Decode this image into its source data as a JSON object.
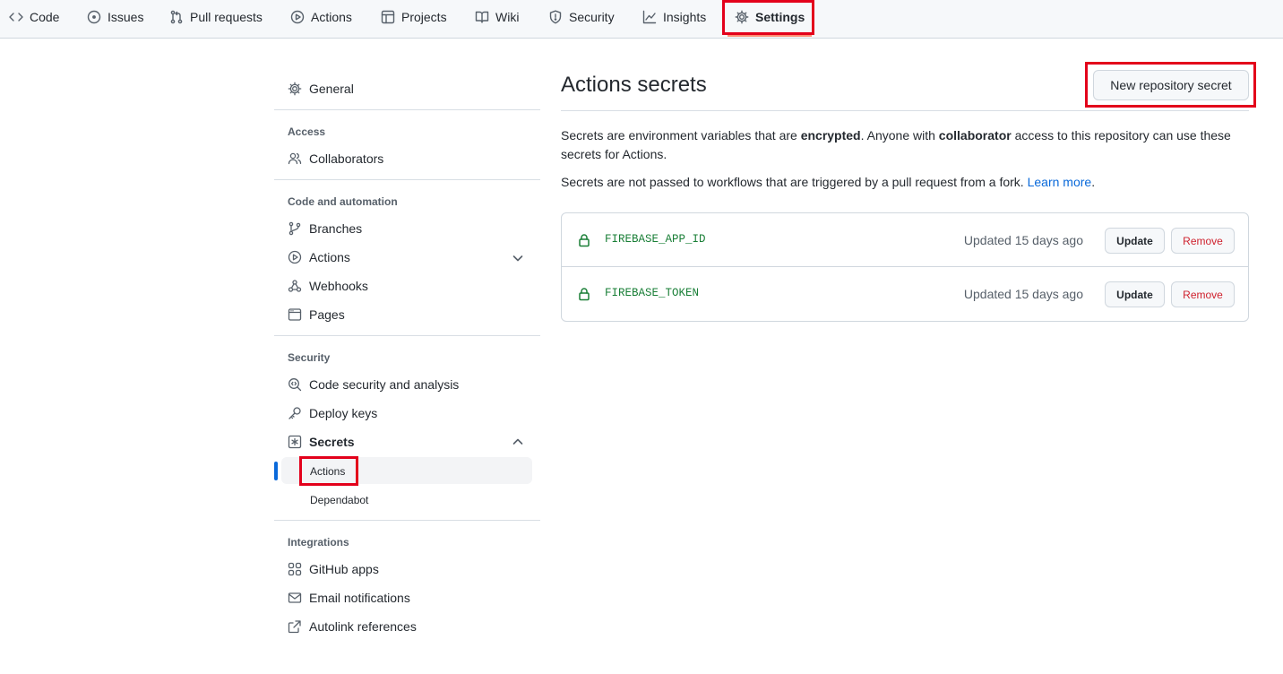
{
  "nav": {
    "tabs": [
      {
        "label": "Code",
        "icon": "code-icon"
      },
      {
        "label": "Issues",
        "icon": "issue-opened-icon"
      },
      {
        "label": "Pull requests",
        "icon": "git-pull-request-icon"
      },
      {
        "label": "Actions",
        "icon": "play-icon"
      },
      {
        "label": "Projects",
        "icon": "table-icon"
      },
      {
        "label": "Wiki",
        "icon": "book-icon"
      },
      {
        "label": "Security",
        "icon": "shield-icon"
      },
      {
        "label": "Insights",
        "icon": "graph-icon"
      },
      {
        "label": "Settings",
        "icon": "gear-icon",
        "selected": true
      }
    ]
  },
  "sidebar": {
    "general": "General",
    "access_heading": "Access",
    "collaborators": "Collaborators",
    "code_heading": "Code and automation",
    "branches": "Branches",
    "actions": "Actions",
    "webhooks": "Webhooks",
    "pages": "Pages",
    "security_heading": "Security",
    "code_security": "Code security and analysis",
    "deploy_keys": "Deploy keys",
    "secrets": "Secrets",
    "secrets_actions": "Actions",
    "secrets_dependabot": "Dependabot",
    "integrations_heading": "Integrations",
    "github_apps": "GitHub apps",
    "email_notifications": "Email notifications",
    "autolink_references": "Autolink references"
  },
  "main": {
    "title": "Actions secrets",
    "new_button": "New repository secret",
    "desc1_a": "Secrets are environment variables that are ",
    "desc1_b": "encrypted",
    "desc1_c": ". Anyone with ",
    "desc1_d": "collaborator",
    "desc1_e": " access to this repository can use these secrets for Actions.",
    "desc2_a": "Secrets are not passed to workflows that are triggered by a pull request from a fork. ",
    "desc2_link": "Learn more",
    "desc2_end": ".",
    "secrets": [
      {
        "name": "FIREBASE_APP_ID",
        "updated": "Updated 15 days ago",
        "update_label": "Update",
        "remove_label": "Remove"
      },
      {
        "name": "FIREBASE_TOKEN",
        "updated": "Updated 15 days ago",
        "update_label": "Update",
        "remove_label": "Remove"
      }
    ]
  },
  "colors": {
    "highlight_box": "#e3001b",
    "accent_blue": "#0969da",
    "secret_green": "#1a7f37",
    "danger_red": "#cf222e",
    "selected_tab_underline": "#fd8c73"
  }
}
